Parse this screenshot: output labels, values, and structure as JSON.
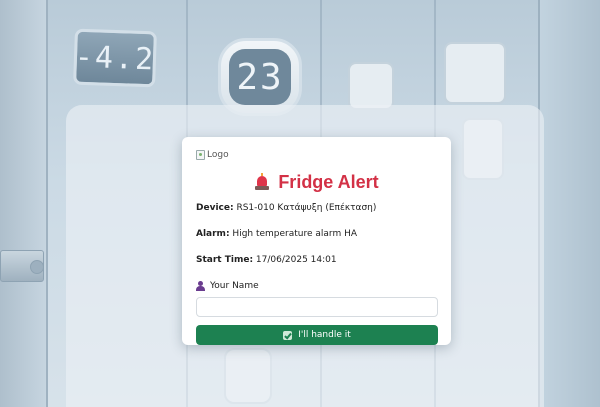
{
  "background": {
    "display_left": "-4.2",
    "display_center": "23"
  },
  "card": {
    "logo_alt": "Logo",
    "title": "Fridge Alert",
    "title_icon": "siren-icon",
    "device_label": "Device:",
    "device_value": "RS1-010 Κατάψυξη (Επέκταση)",
    "alarm_label": "Alarm:",
    "alarm_value": "High temperature alarm HA",
    "start_label": "Start Time:",
    "start_value": "17/06/2025 14:01",
    "name_label": "Your Name",
    "name_icon": "user-icon",
    "name_value": "",
    "handle_button": "I'll handle it",
    "handle_icon": "check-icon"
  },
  "colors": {
    "title": "#d33146",
    "button": "#1d8151",
    "user_icon": "#6a3c8f"
  }
}
